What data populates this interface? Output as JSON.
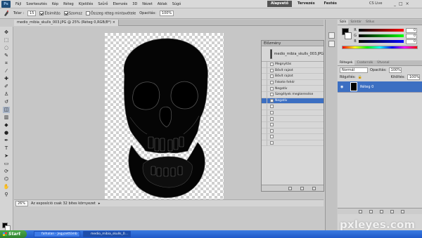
{
  "menubar": {
    "logo": "Ps",
    "items": [
      "Fájl",
      "Szerkesztés",
      "Kép",
      "Réteg",
      "Kijelölés",
      "Szűrő",
      "Elemzés",
      "3D",
      "Nézet",
      "Ablak",
      "Súgó"
    ],
    "workspaces": [
      {
        "label": "Alapvető",
        "active": true
      },
      {
        "label": "Tervezés",
        "active": false
      },
      {
        "label": "Festés",
        "active": false
      }
    ],
    "cslive": "CS Live",
    "window_controls": [
      "_",
      "□",
      "×"
    ]
  },
  "options": {
    "tolerance_label": "Tolar :",
    "tolerance_value": "15",
    "antialias_label": "Élsimítás",
    "contiguous_label": "Szomsz",
    "all_layers_label": "Összeg réteg mintavétele",
    "opacity_label": "Opacitás:",
    "opacity_value": "100%"
  },
  "document": {
    "tab_label": "medio_mibia_skulls_003.JPG @ 25% (Réteg 0,RGB/8*) ×",
    "zoom": "26%",
    "status_text": "Az exposíció csak 32 bites környezet"
  },
  "history": {
    "title": "Előzmény",
    "snapshot_name": "medio_mibia_skulls_003.JPG",
    "states": [
      {
        "label": "Megnyitás",
        "state": "normal"
      },
      {
        "label": "Bővít rajzot",
        "state": "normal"
      },
      {
        "label": "Bővít rajzot",
        "state": "normal"
      },
      {
        "label": "Fekete fehér",
        "state": "normal"
      },
      {
        "label": "Negatív",
        "state": "normal"
      },
      {
        "label": "Szegélyek megkeresése",
        "state": "normal"
      },
      {
        "label": "Negatív",
        "state": "selected"
      },
      {
        "label": "",
        "state": "dim"
      },
      {
        "label": "",
        "state": "dim"
      },
      {
        "label": "",
        "state": "dim"
      },
      {
        "label": "",
        "state": "dim"
      },
      {
        "label": "",
        "state": "dim"
      },
      {
        "label": "",
        "state": "dim"
      },
      {
        "label": "",
        "state": "dim"
      }
    ]
  },
  "color_panel": {
    "tabs": [
      {
        "label": "Szín",
        "active": true
      },
      {
        "label": "Színtár",
        "active": false
      },
      {
        "label": "Stílus",
        "active": false
      }
    ],
    "sliders": [
      {
        "label": "R",
        "value": "0",
        "gradient_from": "#000000",
        "gradient_to": "#ff0000"
      },
      {
        "label": "G",
        "value": "0",
        "gradient_from": "#000000",
        "gradient_to": "#00ff00"
      },
      {
        "label": "B",
        "value": "0",
        "gradient_from": "#000000",
        "gradient_to": "#0000ff"
      }
    ],
    "foreground": "#000000",
    "background": "#ffffff"
  },
  "layers_panel": {
    "tabs": [
      {
        "label": "Rétegek",
        "active": true
      },
      {
        "label": "Csatornák",
        "active": false
      },
      {
        "label": "Útvonal",
        "active": false
      }
    ],
    "blend_mode": "Normál",
    "opacity_label": "Opacitás:",
    "opacity_value": "100%",
    "lock_label": "Rögzítés:",
    "fill_label": "Kitöltés:",
    "fill_value": "100%",
    "layer_name": "Réteg 0"
  },
  "taskbar": {
    "start_label": "Start",
    "buttons": [
      {
        "label": "falhalan - Jegyzettömb",
        "active": false
      },
      {
        "label": "medio_mibia_skulls_0...",
        "active": true
      }
    ]
  },
  "watermark": "pxleyes.com",
  "colors": {
    "selection": "#3c6fc2",
    "taskbar": "#2461d4",
    "start": "#3a9a3a"
  }
}
